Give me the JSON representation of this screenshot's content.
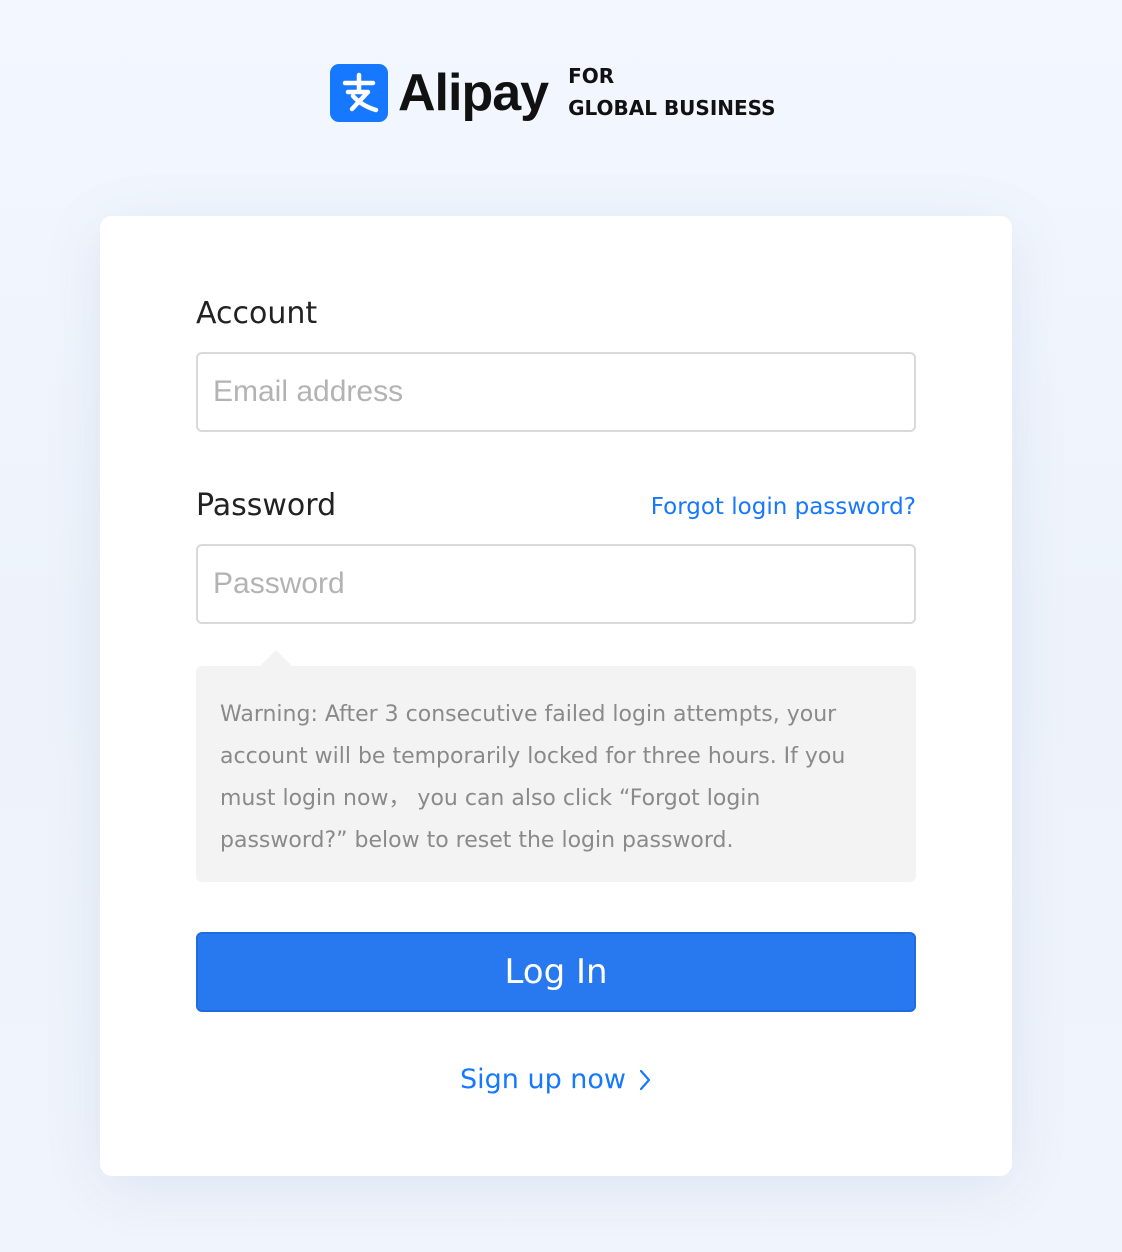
{
  "brand": {
    "name": "Alipay",
    "tagline_line1": "FOR",
    "tagline_line2": "GLOBAL BUSINESS",
    "color": "#1677ff"
  },
  "form": {
    "account_label": "Account",
    "email_placeholder": "Email address",
    "password_label": "Password",
    "forgot_link": "Forgot login password?",
    "password_placeholder": "Password",
    "warning_text": "Warning: After 3 consecutive failed login attempts, your account will be temporarily locked for three hours. If you must login now， you can also click “Forgot login password?” below to reset the login password.",
    "login_button": "Log In",
    "signup_link": "Sign up now"
  },
  "icons": {
    "logo": "alipay-logo-icon",
    "signup_arrow": "chevron-right-icon"
  },
  "colors": {
    "primary_button": "#2878f0",
    "link": "#1677ff",
    "warning_bg": "#f3f3f3",
    "warning_text": "#8a8a8a"
  }
}
